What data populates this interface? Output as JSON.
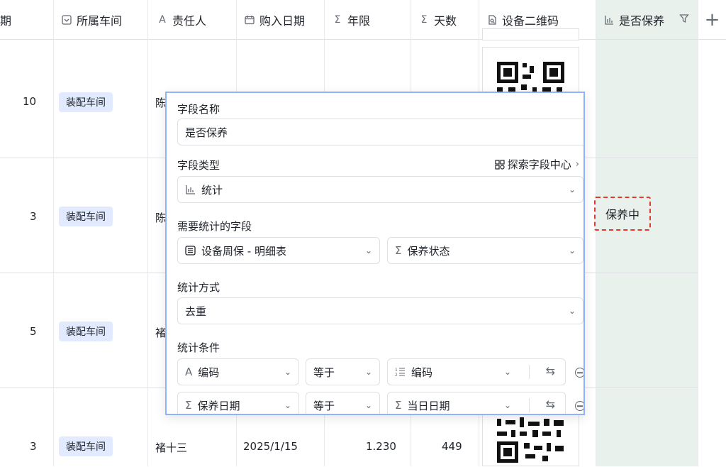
{
  "headers": [
    {
      "label": "期",
      "icon": "calendar-icon"
    },
    {
      "label": "所属车间",
      "icon": "single-select-icon"
    },
    {
      "label": "责任人",
      "icon": "text-icon"
    },
    {
      "label": "购入日期",
      "icon": "calendar-icon"
    },
    {
      "label": "年限",
      "icon": "sigma-icon"
    },
    {
      "label": "天数",
      "icon": "sigma-icon"
    },
    {
      "label": "设备二维码",
      "icon": "attachment-icon"
    },
    {
      "label": "是否保养",
      "icon": "stats-icon"
    }
  ],
  "add_column": "+",
  "rows": [
    {
      "period": "10",
      "workshop": "装配车间",
      "owner": "陈",
      "date": "",
      "years": "",
      "days": ""
    },
    {
      "period": "3",
      "workshop": "装配车间",
      "owner": "陈",
      "date": "",
      "years": "",
      "days": ""
    },
    {
      "period": "5",
      "workshop": "装配车间",
      "owner": "褚",
      "date": "",
      "years": "",
      "days": ""
    },
    {
      "period": "3",
      "workshop": "装配车间",
      "owner": "褚十三",
      "date": "2025/1/15",
      "years": "1.230",
      "days": "449"
    }
  ],
  "maintenance_value": "保养中",
  "panel": {
    "field_name_label": "字段名称",
    "field_name_value": "是否保养",
    "field_type_label": "字段类型",
    "explore_label": "探索字段中心",
    "field_type_value": "统计",
    "stat_field_label": "需要统计的字段",
    "stat_table_value": "设备周保 - 明细表",
    "stat_field_value": "保养状态",
    "method_label": "统计方式",
    "method_value": "去重",
    "conditions_label": "统计条件",
    "conditions": [
      {
        "field": "编码",
        "op": "等于",
        "value": "编码"
      },
      {
        "field": "保养日期",
        "op": "等于",
        "value": "当日日期"
      }
    ]
  }
}
